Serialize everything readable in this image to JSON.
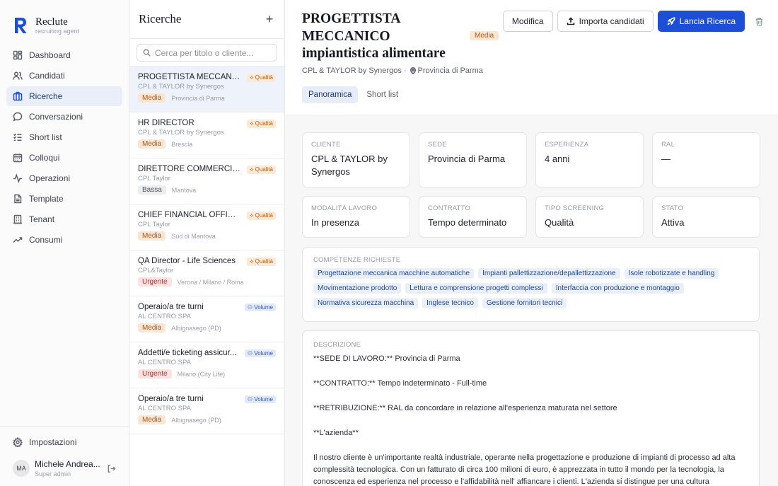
{
  "brand": {
    "name": "Reclute",
    "tagline": "recruiting agent",
    "accent": "#1d4ed8"
  },
  "nav": {
    "items": [
      {
        "label": "Dashboard",
        "icon": "dashboard-icon"
      },
      {
        "label": "Candidati",
        "icon": "users-icon"
      },
      {
        "label": "Ricerche",
        "icon": "briefcase-icon",
        "active": true
      },
      {
        "label": "Conversazioni",
        "icon": "chat-icon"
      },
      {
        "label": "Short list",
        "icon": "list-check-icon"
      },
      {
        "label": "Colloqui",
        "icon": "calendar-icon"
      },
      {
        "label": "Operazioni",
        "icon": "activity-icon"
      },
      {
        "label": "Template",
        "icon": "document-icon"
      },
      {
        "label": "Tenant",
        "icon": "building-icon"
      },
      {
        "label": "Consumi",
        "icon": "trend-icon"
      }
    ],
    "settings": "Impostazioni",
    "user": {
      "initials": "MA",
      "name": "Michele Andrea...",
      "role": "Super admin"
    }
  },
  "list": {
    "title": "Ricerche",
    "search_placeholder": "Cerca per titolo o cliente...",
    "rows": [
      {
        "title": "PROGETTISTA MECCANIC...",
        "client": "CPL & TAYLOR by Synergos",
        "priority": "Media",
        "location": "Provincia di Parma",
        "badge": "Qualità"
      },
      {
        "title": "HR DIRECTOR",
        "client": "CPL & TAYLOR by Synergos",
        "priority": "Media",
        "location": "Brescia",
        "badge": "Qualità"
      },
      {
        "title": "DIRETTORE COMMERCIALE",
        "client": "CPL Taylor",
        "priority": "Bassa",
        "location": "Mantova",
        "badge": "Qualità"
      },
      {
        "title": "CHIEF FINANCIAL OFFICE...",
        "client": "CPL Taylor",
        "priority": "Media",
        "location": "Sud di Mantova",
        "badge": "Qualità"
      },
      {
        "title": "QA Director - Life Sciences",
        "client": "CPL&Taylor",
        "priority": "Urgente",
        "location": "Verona / Milano / Roma",
        "badge": "Qualità"
      },
      {
        "title": "Operaio/a tre turni",
        "client": "AL CENTRO SPA",
        "priority": "Media",
        "location": "Albignasego (PD)",
        "badge": "Volume"
      },
      {
        "title": "Addetti/e ticketing assicur...",
        "client": "AL CENTRO SPA",
        "priority": "Urgente",
        "location": "Milano (City Life)",
        "badge": "Volume"
      },
      {
        "title": "Operaio/a tre turni",
        "client": "AL CENTRO SPA",
        "priority": "Media",
        "location": "Albignasego (PD)",
        "badge": "Volume"
      }
    ]
  },
  "detail": {
    "title_lines": [
      "PROGETTISTA",
      "MECCANICO",
      "impiantistica alimentare"
    ],
    "priority": "Media",
    "client": "CPL & TAYLOR by Synergos ·",
    "location": "Provincia di Parma",
    "actions": {
      "edit": "Modifica",
      "import": "Importa candidati",
      "launch": "Lancia Ricerca"
    },
    "tabs": [
      "Panoramica",
      "Short list"
    ],
    "fields": [
      {
        "label": "CLIENTE",
        "value": "CPL & TAYLOR by Synergos"
      },
      {
        "label": "SEDE",
        "value": "Provincia di Parma"
      },
      {
        "label": "ESPERIENZA",
        "value": "4 anni"
      },
      {
        "label": "RAL",
        "value": "—"
      },
      {
        "label": "MODALITÀ LAVORO",
        "value": "In presenza"
      },
      {
        "label": "CONTRATTO",
        "value": "Tempo determinato"
      },
      {
        "label": "TIPO SCREENING",
        "value": "Qualità"
      },
      {
        "label": "STATO",
        "value": "Attiva"
      }
    ],
    "skills_label": "COMPETENZE RICHIESTE",
    "skills": [
      "Progettazione meccanica macchine automatiche",
      "Impianti pallettizzazione/depallettizzazione",
      "Isole robotizzate e handling",
      "Movimentazione prodotto",
      "Lettura e comprensione progetti complessi",
      "Interfaccia con produzione e montaggio",
      "Normativa sicurezza macchina",
      "Inglese tecnico",
      "Gestione fornitori tecnici"
    ],
    "description_label": "DESCRIZIONE",
    "description": [
      "**SEDE DI LAVORO:** Provincia di Parma",
      "**CONTRATTO:** Tempo indeterminato - Full-time",
      "**RETRIBUZIONE:** RAL da concordare in relazione all'esperienza maturata nel settore",
      "**L'azienda**",
      "Il nostro cliente è un'importante realtà industriale, operante nella progettazione e produzione di impianti di processo ad alta complessità tecnologica. Con un fatturato di circa 100 milioni di euro, è apprezzata in tutto il mondo per la tecnologia, la conoscenza ed esperienza nel processo e l'affidabilità nell' affiancare i clienti. L'azienda si distingue per una cultura"
    ]
  }
}
